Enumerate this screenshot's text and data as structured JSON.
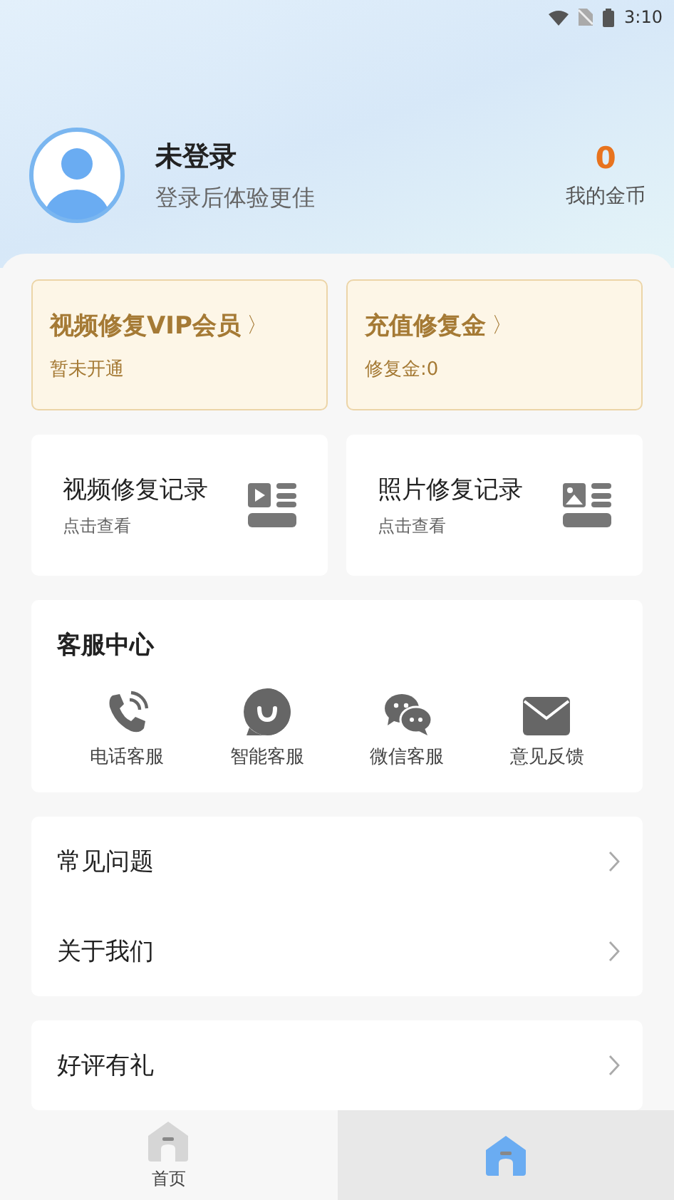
{
  "status_bar": {
    "time": "3:10"
  },
  "profile": {
    "name": "未登录",
    "subtitle": "登录后体验更佳",
    "coins": "0",
    "coins_label": "我的金币"
  },
  "promo_cards": [
    {
      "title": "视频修复VIP会员",
      "chevron": "〉",
      "subtitle": "暂未开通"
    },
    {
      "title": "充值修复金",
      "chevron": "〉",
      "subtitle": "修复金:0"
    }
  ],
  "record_cards": [
    {
      "kind": "video",
      "title": "视频修复记录",
      "subtitle": "点击查看"
    },
    {
      "kind": "photo",
      "title": "照片修复记录",
      "subtitle": "点击查看"
    }
  ],
  "service": {
    "title": "客服中心",
    "items": [
      {
        "kind": "phone",
        "label": "电话客服"
      },
      {
        "kind": "bot",
        "label": "智能客服"
      },
      {
        "kind": "chat",
        "label": "微信客服"
      },
      {
        "kind": "mail",
        "label": "意见反馈"
      }
    ]
  },
  "menu_groups": [
    [
      {
        "label": "常见问题"
      },
      {
        "label": "关于我们"
      }
    ],
    [
      {
        "label": "好评有礼"
      }
    ]
  ],
  "tabs": [
    {
      "label": "首页",
      "selected": false
    },
    {
      "selected": true
    }
  ]
}
